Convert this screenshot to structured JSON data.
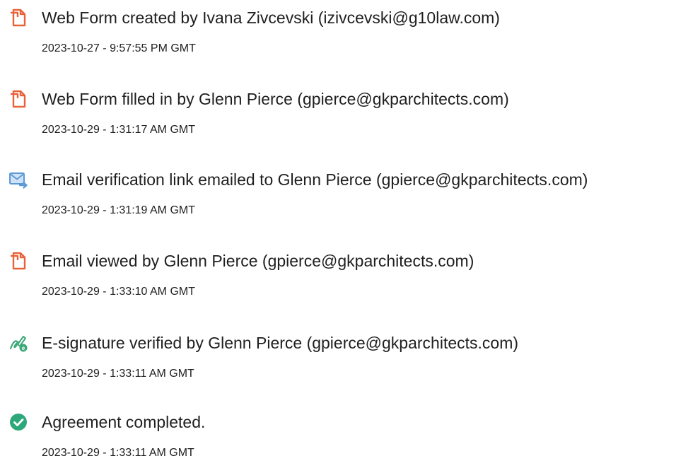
{
  "events": [
    {
      "icon": "document-icon",
      "title": "Web Form created by Ivana Zivcevski (izivcevski@g10law.com)",
      "time": "2023-10-27 - 9:57:55 PM GMT"
    },
    {
      "icon": "document-icon",
      "title": "Web Form filled in by Glenn Pierce (gpierce@gkparchitects.com)",
      "time": "2023-10-29 - 1:31:17 AM GMT"
    },
    {
      "icon": "email-send-icon",
      "title": "Email verification link emailed to Glenn Pierce (gpierce@gkparchitects.com)",
      "time": "2023-10-29 - 1:31:19 AM GMT"
    },
    {
      "icon": "document-icon",
      "title": "Email viewed by Glenn Pierce (gpierce@gkparchitects.com)",
      "time": "2023-10-29 - 1:33:10 AM GMT"
    },
    {
      "icon": "signature-verified-icon",
      "title": "E-signature verified by Glenn Pierce (gpierce@gkparchitects.com)",
      "time": "2023-10-29 - 1:33:11 AM GMT"
    },
    {
      "icon": "checkmark-icon",
      "title": "Agreement completed.",
      "time": "2023-10-29 - 1:33:11 AM GMT"
    }
  ],
  "colors": {
    "document": "#e8623a",
    "email": "#5b9bd5",
    "signature": "#3ca87a",
    "check": "#2ea87a"
  }
}
